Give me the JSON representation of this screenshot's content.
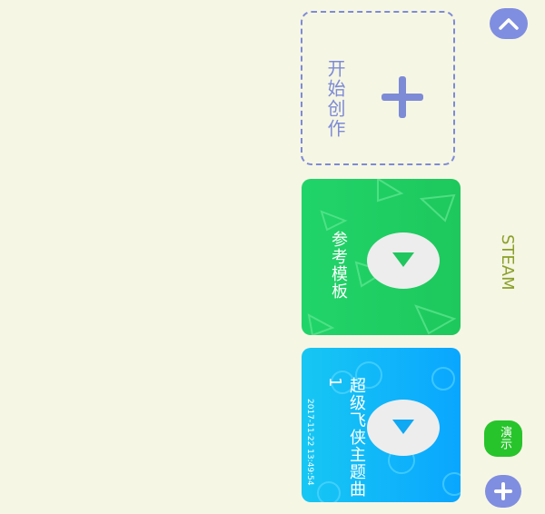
{
  "create_card": {
    "label": "开始创作"
  },
  "cards": [
    {
      "title": "参考模板",
      "color": "#1fd061",
      "date": ""
    },
    {
      "title": "超级飞侠主题曲1",
      "color": "#14b7fa",
      "date": "2017-11-22 13:49:54"
    }
  ],
  "side": {
    "steam_label": "STEAM",
    "demo_label": "演示"
  },
  "icons": {
    "top_button": "chevron-up-icon",
    "bottom_button": "plus-icon",
    "play": "play-icon"
  }
}
